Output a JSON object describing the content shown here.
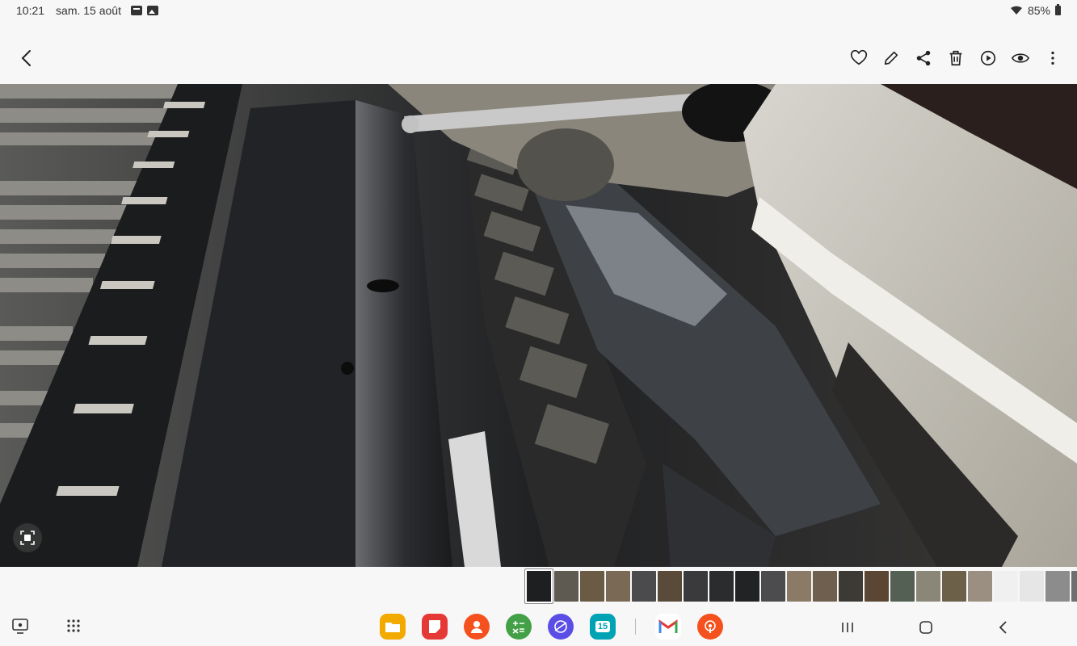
{
  "status_bar": {
    "time": "10:21",
    "date": "sam. 15 août",
    "battery": "85%"
  },
  "toolbar": {
    "back_icon": "chevron-left-icon",
    "actions": [
      "heart-icon",
      "pencil-icon",
      "share-icon",
      "trash-icon",
      "remaster-icon",
      "eye-icon",
      "more-vert-icon"
    ]
  },
  "photo": {
    "description_colors": {
      "metal_dark": "#1c1d1f",
      "metal_light": "#c9c7c0",
      "rod": "#b8b8b8"
    }
  },
  "filmstrip": {
    "thumb_colors": [
      "#1e1f20",
      "#5e5a52",
      "#6b5a44",
      "#7a6a55",
      "#4b4b4e",
      "#5a4a3a",
      "#3a3a3c",
      "#2b2c2e",
      "#222324",
      "#4c4c4f",
      "#8a7a66",
      "#6e5f4e",
      "#3d3a36",
      "#5b4633",
      "#556055",
      "#8b8778",
      "#6c6048",
      "#9a8f80",
      "#f0f0f0",
      "#e6e6e6",
      "#8c8c8c",
      "#6f6f6f",
      "#5e5e5e"
    ]
  },
  "taskbar": {
    "apps": [
      {
        "name": "files-app",
        "color": "#f2a900"
      },
      {
        "name": "notes-app",
        "color": "#e53935"
      },
      {
        "name": "contacts-app",
        "color": "#f4511e"
      },
      {
        "name": "calculator-app",
        "color": "#43a047"
      },
      {
        "name": "internet-app",
        "color": "#5b4ee6"
      },
      {
        "name": "calendar-app",
        "color": "#00a3b4",
        "label": "15"
      },
      {
        "name": "gmail-app",
        "color": "#ffffff"
      },
      {
        "name": "podcast-app",
        "color": "#f4511e"
      }
    ]
  }
}
